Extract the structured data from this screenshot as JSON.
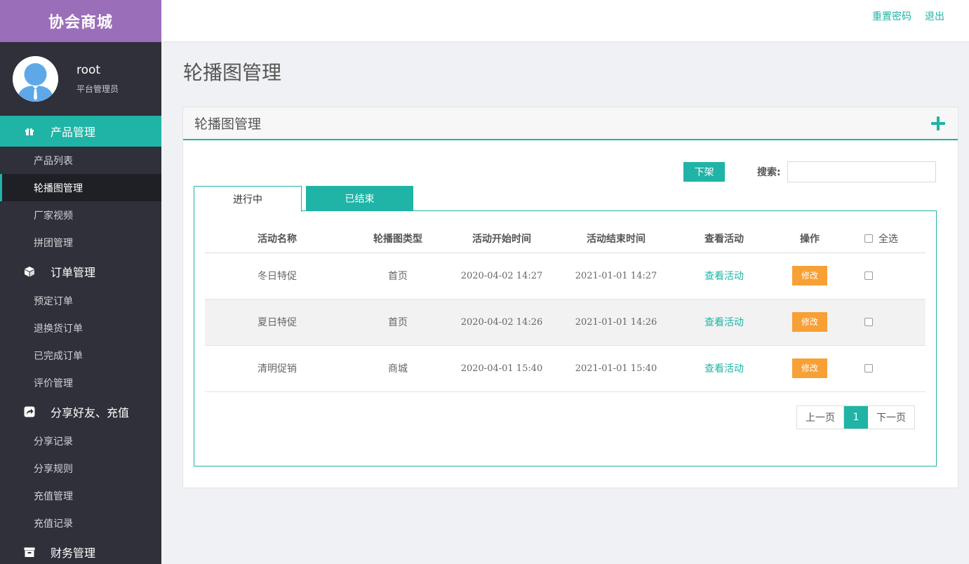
{
  "app": {
    "brand": "协会商城"
  },
  "user": {
    "name": "root",
    "role": "平台管理员"
  },
  "topbar": {
    "reset_password": "重置密码",
    "logout": "退出"
  },
  "sidebar": {
    "groups": [
      {
        "label": "产品管理",
        "icon": "gift-icon",
        "items": [
          "产品列表",
          "轮播图管理",
          "厂家视频",
          "拼团管理"
        ]
      },
      {
        "label": "订单管理",
        "icon": "cube-icon",
        "items": [
          "预定订单",
          "退换货订单",
          "已完成订单",
          "评价管理"
        ]
      },
      {
        "label": "分享好友、充值",
        "icon": "share-icon",
        "items": [
          "分享记录",
          "分享规则",
          "充值管理",
          "充值记录"
        ]
      },
      {
        "label": "财务管理",
        "icon": "archive-icon",
        "items": []
      }
    ],
    "active_item": "轮播图管理"
  },
  "page": {
    "title": "轮播图管理"
  },
  "panel": {
    "title": "轮播图管理",
    "offline_button": "下架",
    "search_label": "搜索:",
    "search_value": "",
    "tabs": [
      "进行中",
      "已结束"
    ],
    "active_tab": "进行中"
  },
  "table": {
    "headers": [
      "活动名称",
      "轮播图类型",
      "活动开始时间",
      "活动结束时间",
      "查看活动",
      "操作",
      "全选"
    ],
    "rows": [
      {
        "name": "冬日特促",
        "type": "首页",
        "start": "2020-04-02 14:27",
        "end": "2021-01-01 14:27",
        "view": "查看活动",
        "action": "修改"
      },
      {
        "name": "夏日特促",
        "type": "首页",
        "start": "2020-04-02 14:26",
        "end": "2021-01-01 14:26",
        "view": "查看活动",
        "action": "修改"
      },
      {
        "name": "清明促销",
        "type": "商城",
        "start": "2020-04-01 15:40",
        "end": "2021-01-01 15:40",
        "view": "查看活动",
        "action": "修改"
      }
    ]
  },
  "pagination": {
    "prev": "上一页",
    "current": "1",
    "next": "下一页"
  },
  "colors": {
    "accent": "#1fb4a6",
    "brand": "#9b6eb9",
    "sidebar": "#2f3039",
    "edit": "#f7a035"
  }
}
